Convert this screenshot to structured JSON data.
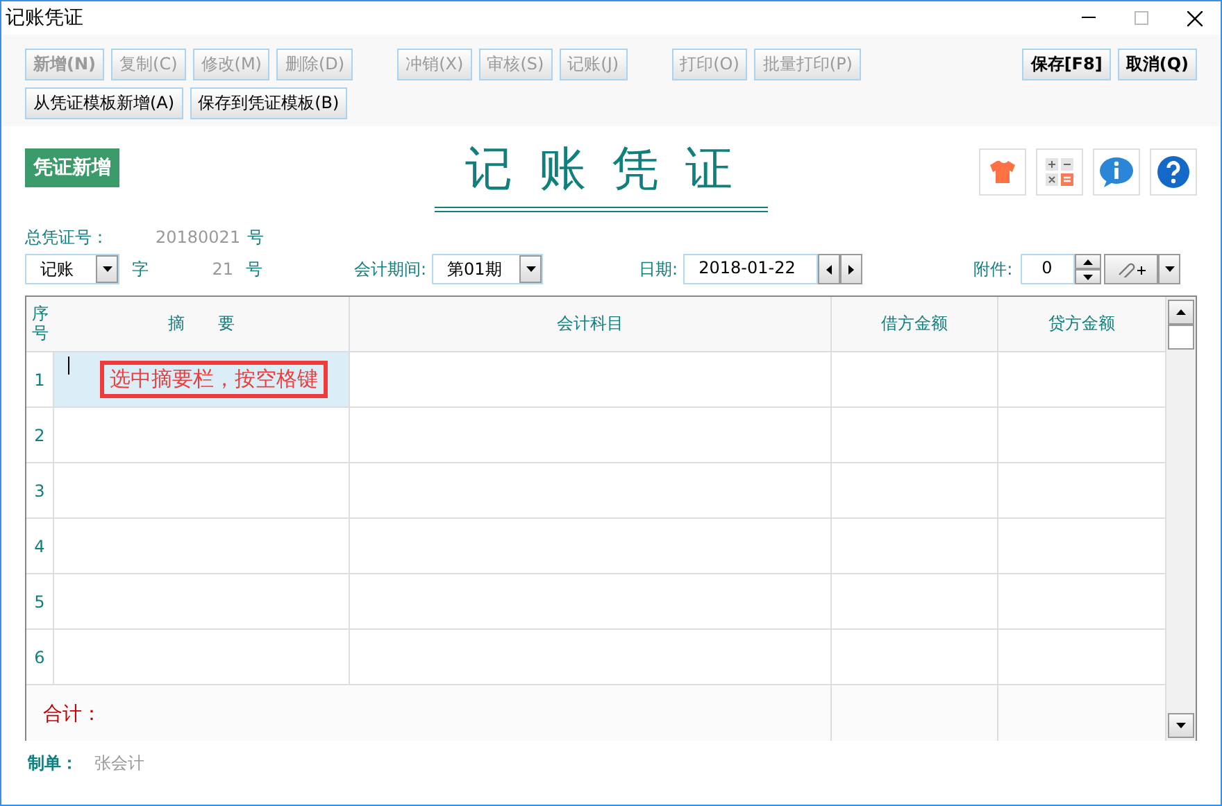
{
  "window": {
    "title": "记账凭证"
  },
  "toolbar": [
    {
      "groups": [
        [
          {
            "label": "新增(N)",
            "disabled": true,
            "emphasis": true
          },
          {
            "label": "复制(C)",
            "disabled": true,
            "emphasis": false
          },
          {
            "label": "修改(M)",
            "disabled": true,
            "emphasis": false
          },
          {
            "label": "删除(D)",
            "disabled": true,
            "emphasis": false
          }
        ],
        [
          {
            "label": "冲销(X)",
            "disabled": true,
            "emphasis": false
          },
          {
            "label": "审核(S)",
            "disabled": true,
            "emphasis": false
          },
          {
            "label": "记账(J)",
            "disabled": true,
            "emphasis": false
          }
        ],
        [
          {
            "label": "打印(O)",
            "disabled": true,
            "emphasis": false
          },
          {
            "label": "批量打印(P)",
            "disabled": true,
            "emphasis": false
          }
        ],
        [
          {
            "label": "保存[F8]",
            "disabled": false,
            "emphasis": true
          },
          {
            "label": "取消(Q)",
            "disabled": false,
            "emphasis": true
          }
        ]
      ]
    },
    {
      "groups": [
        [
          {
            "label": "从凭证模板新增(A)",
            "disabled": false,
            "emphasis": false
          },
          {
            "label": "保存到凭证模板(B)",
            "disabled": false,
            "emphasis": false
          }
        ]
      ]
    }
  ],
  "mode_badge": "凭证新增",
  "voucher_title": "记 账 凭 证",
  "total_number": {
    "label": "总凭证号：",
    "value": "20180021",
    "unit": "号"
  },
  "voucher_type": {
    "value": "记账",
    "word": "字",
    "number": "21",
    "unit": "号"
  },
  "period": {
    "label": "会计期间:",
    "value": "第01期"
  },
  "date": {
    "label": "日期:",
    "value": "2018-01-22"
  },
  "attachments": {
    "label": "附件:",
    "value": "0"
  },
  "table": {
    "columns": [
      "序号",
      "摘　　要",
      "会计科目",
      "借方金额",
      "贷方金额"
    ],
    "rows": [
      {
        "number": "1",
        "selected": true,
        "callout": "选中摘要栏，按空格键"
      },
      {
        "number": "2",
        "selected": false
      },
      {
        "number": "3",
        "selected": false
      },
      {
        "number": "4",
        "selected": false
      },
      {
        "number": "5",
        "selected": false
      },
      {
        "number": "6",
        "selected": false
      }
    ],
    "total_label": "合计："
  },
  "footer": {
    "label": "制单：",
    "value": "张会计"
  }
}
